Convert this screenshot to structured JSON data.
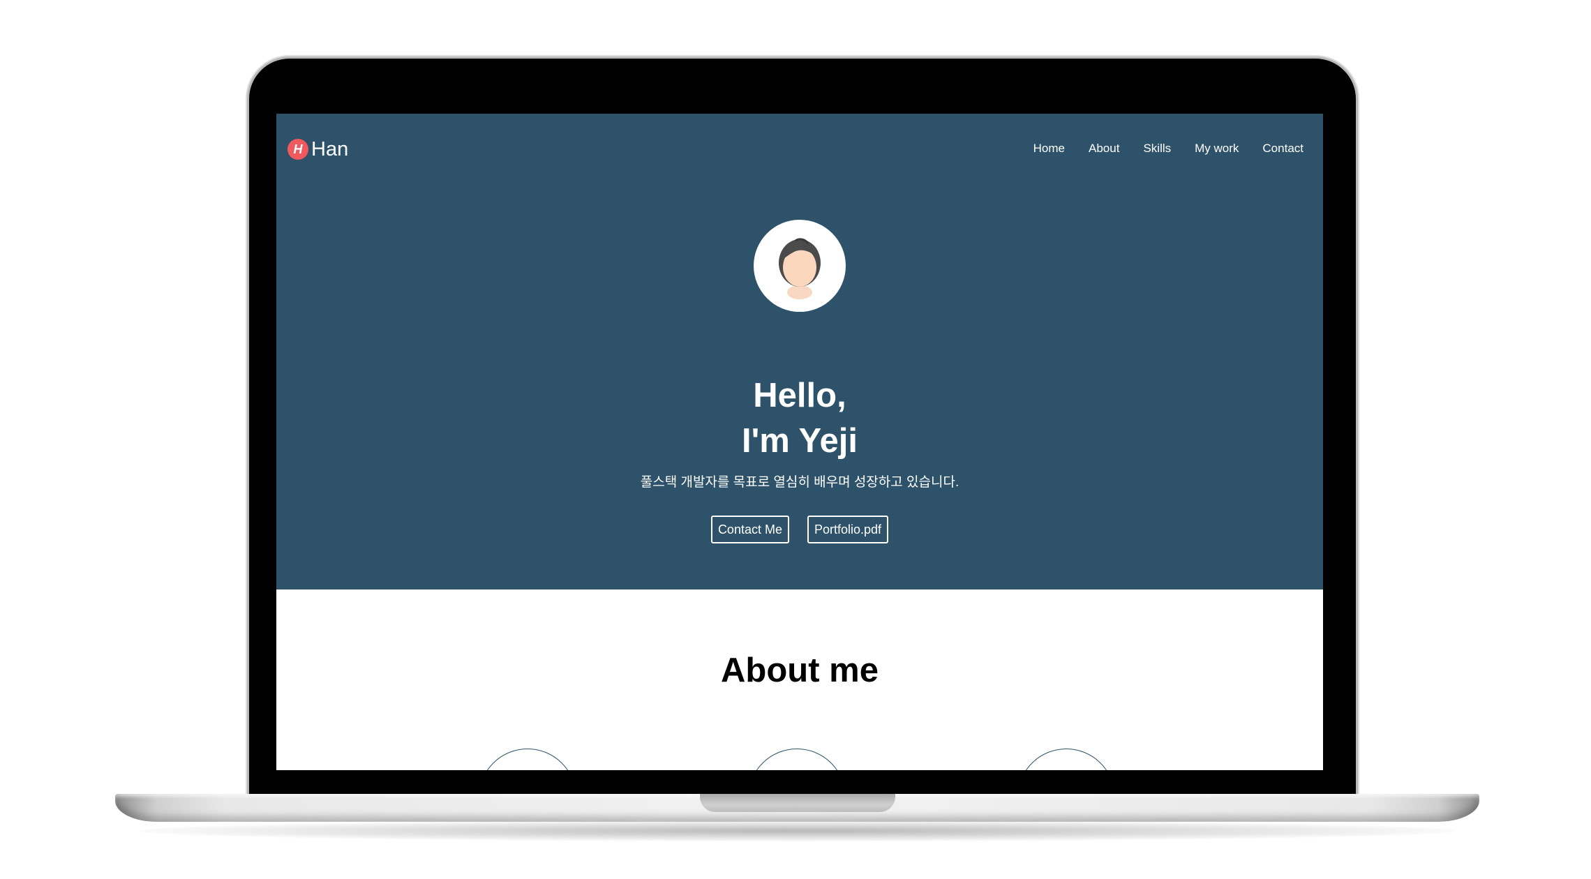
{
  "header": {
    "logo_letter": "H",
    "logo_text": "Han",
    "nav": [
      "Home",
      "About",
      "Skills",
      "My work",
      "Contact"
    ]
  },
  "hero": {
    "greeting_line1": "Hello,",
    "greeting_line2": "I'm Yeji",
    "tagline": "풀스택 개발자를 목표로 열심히 배우며 성장하고 있습니다.",
    "buttons": [
      "Contact Me",
      "Portfolio.pdf"
    ]
  },
  "about": {
    "title": "About me"
  },
  "colors": {
    "hero_background": "#2e526a",
    "logo_badge": "#f05a5e",
    "text_light": "#ffffff"
  },
  "icons": [
    "avatar-icon",
    "logo-icon"
  ]
}
